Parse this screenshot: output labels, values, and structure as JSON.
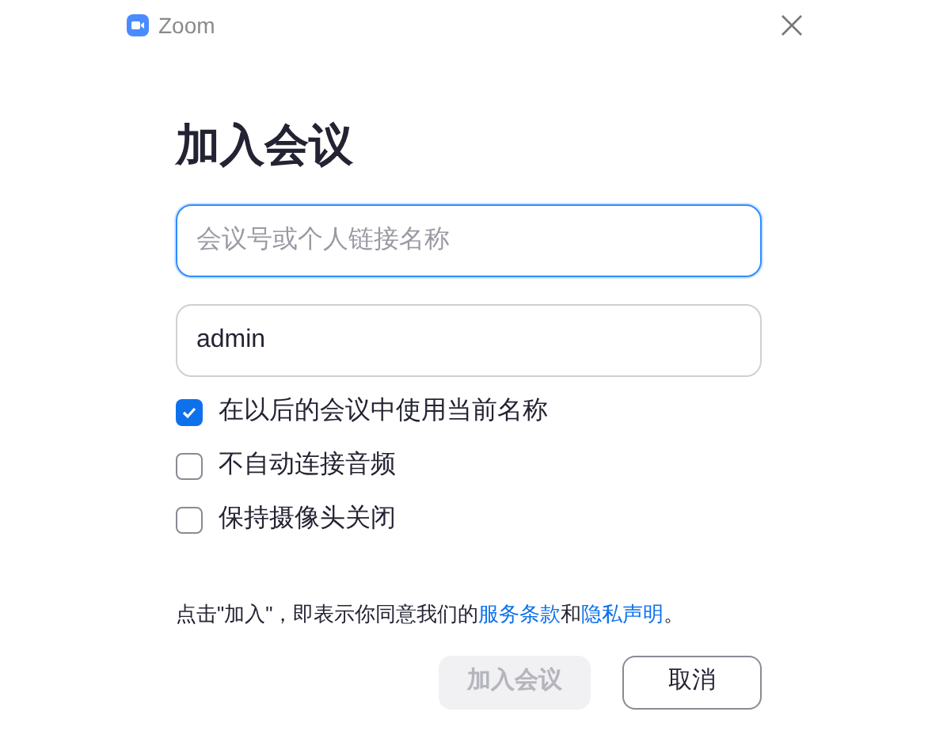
{
  "window": {
    "title": "Zoom"
  },
  "heading": "加入会议",
  "fields": [
    {
      "placeholder": "会议号或个人链接名称",
      "focused": true
    },
    {
      "value": "admin",
      "focused": false
    }
  ],
  "options": [
    {
      "label": "在以后的会议中使用当前名称",
      "checked": true
    },
    {
      "label": "不自动连接音频",
      "checked": false
    },
    {
      "label": "保持摄像头关闭",
      "checked": false
    }
  ],
  "agreement": [
    {
      "kind": "text",
      "text": "点击\"加入\"，即表示你同意我们的"
    },
    {
      "kind": "link",
      "text": "服务条款"
    },
    {
      "kind": "text",
      "text": "和"
    },
    {
      "kind": "link",
      "text": "隐私声明"
    },
    {
      "kind": "text",
      "text": "。"
    }
  ],
  "buttons": [
    {
      "label": "加入会议",
      "disabled": true
    },
    {
      "label": "取消",
      "disabled": false
    }
  ]
}
